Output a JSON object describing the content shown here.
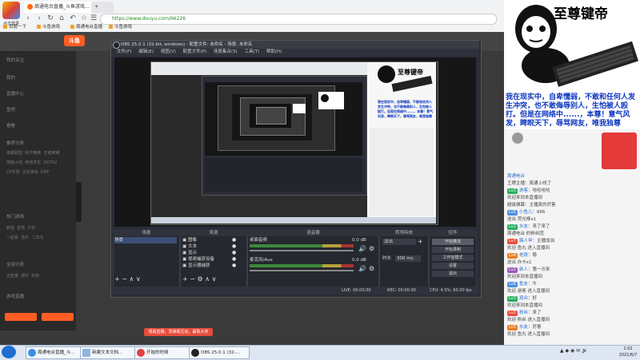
{
  "browser": {
    "profile_label": "点击登录",
    "tabs": [
      {
        "title": "周通电台直播_斗鱼游戏..."
      },
      {
        "title": "新标签页"
      }
    ],
    "url": "https://www.douyu.com/66226",
    "bookmarks": [
      "百度一下",
      "斗鱼游戏",
      "周通电台直播",
      "斗鱼游戏"
    ]
  },
  "douyu": {
    "logo_text": "斗鱼",
    "sidebar_items": [
      "我的关注",
      "我的",
      "直播中心",
      "鱼吧",
      "看看",
      "推荐分类",
      "热门游戏",
      "全部分类",
      "游戏直播"
    ],
    "sidebar_grid": [
      [
        "英雄联盟",
        "和平精英",
        "王者荣耀"
      ],
      [
        "穿越火线",
        "绝地求生",
        "DOTA2"
      ],
      [
        "CF手游",
        "主机游戏",
        "DNF"
      ],
      [
        "颜值",
        "星秀",
        "户外"
      ],
      [
        "一起看",
        "音乐",
        "二次元"
      ],
      [
        "正能量",
        "娱乐",
        "科技"
      ]
    ],
    "banner_text": "观看直播，发弹幕互动，赢取大奖"
  },
  "obs": {
    "title": "OBS 25.0.1 (32-bit, windows) - 配置文件: 未命名 - 场景: 未命名",
    "menu": [
      "文件(F)",
      "编辑(E)",
      "视图(V)",
      "配置文件(P)",
      "场景集合(S)",
      "工具(T)",
      "帮助(H)"
    ],
    "panels": {
      "scenes_title": "场景",
      "sources_title": "来源",
      "mixer_title": "混音器",
      "transitions_title": "转场特效",
      "controls_title": "控件"
    },
    "scene_items": [
      "场景"
    ],
    "source_items": [
      "图像",
      "文本",
      "显示",
      "视频捕获设备",
      "显示器捕获"
    ],
    "mixer": [
      {
        "label": "桌面音频",
        "db": "0.0 dB"
      },
      {
        "label": "麦克风/Aux",
        "db": "0.0 dB"
      }
    ],
    "transition": {
      "type": "淡出",
      "duration_label": "时长",
      "duration_value": "300 ms"
    },
    "controls": [
      "开始推流",
      "开始录制",
      "工作室模式",
      "设置",
      "退出"
    ],
    "status": {
      "live": "LIVE: 00:00:00",
      "rec": "REC: 00:00:00",
      "cpu": "CPU: 4.5%, 60.00 fps"
    }
  },
  "meme": {
    "title": "至尊键帝",
    "text": "我在现实中，自卑懦弱，不敢和任何人发生冲突，也不敢侮辱别人，生怕被人殴打。但是在网络中......，本尊！意气风发，睥睨天下，辱骂网友，唯我独尊"
  },
  "chat": {
    "lines": [
      {
        "badge": "",
        "name": "周通电台",
        "text": ""
      },
      {
        "badge": "",
        "name": "",
        "text": "王牌主播：周通上线了"
      },
      {
        "badge": "Lv3",
        "name": "游客",
        "text": "：哈哈哈哈"
      },
      {
        "badge": "",
        "name": "",
        "text": "欢迎来到本直播间"
      },
      {
        "badge": "",
        "name": "",
        "text": "超级弹幕：主播真的厉害"
      },
      {
        "badge": "Lv5",
        "name": "小鱼儿",
        "text": "：666"
      },
      {
        "badge": "",
        "name": "",
        "text": "送出 荧光棒x1"
      },
      {
        "badge": "Lv2",
        "name": "水友",
        "text": "：来了来了"
      },
      {
        "badge": "",
        "name": "",
        "text": "周通电台 的粉丝团"
      },
      {
        "badge": "Lv7",
        "name": "路人甲",
        "text": "：主播加油"
      },
      {
        "badge": "",
        "name": "",
        "text": "欢迎 鱼丸 进入直播间"
      },
      {
        "badge": "Lv4",
        "name": "老铁",
        "text": "：稳"
      },
      {
        "badge": "",
        "name": "",
        "text": "送出 办卡x1"
      },
      {
        "badge": "Lv1",
        "name": "新人",
        "text": "：第一次来"
      },
      {
        "badge": "",
        "name": "",
        "text": "欢迎来到本直播间"
      },
      {
        "badge": "Lv6",
        "name": "鱼友",
        "text": "：牛"
      },
      {
        "badge": "",
        "name": "",
        "text": "欢迎 游客 进入直播间"
      },
      {
        "badge": "Lv3",
        "name": "观众",
        "text": "：好"
      },
      {
        "badge": "",
        "name": "",
        "text": "欢迎来到本直播间"
      },
      {
        "badge": "Lv2",
        "name": "粉丝",
        "text": "：来了"
      },
      {
        "badge": "",
        "name": "",
        "text": "欢迎 粉丝 进入直播间"
      },
      {
        "badge": "Lv5",
        "name": "水友",
        "text": "：厉害"
      },
      {
        "badge": "",
        "name": "",
        "text": "欢迎 鱼丸 进入直播间"
      }
    ]
  },
  "taskbar": {
    "items": [
      "周通电台直播_斗...",
      "新建文本文档...",
      "开始的时候",
      "OBS 25.0.1 (32-..."
    ],
    "time": "1:02",
    "date": "2021/6/7"
  },
  "colors": {
    "douyu_orange": "#ff5d23",
    "obs_bg": "#2b2e38",
    "meme_blue": "#0b36c0",
    "url_green": "#2a8d2a"
  }
}
